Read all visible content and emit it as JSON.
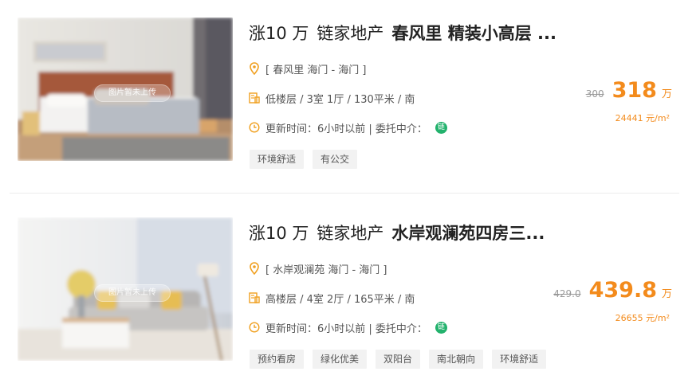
{
  "listings": [
    {
      "title_prefix": "涨10 万",
      "agency": "链家地产",
      "title_name": "春风里 精装小高层 ...",
      "address": "[ 春风里 海门 - 海门 ]",
      "specs": "低楼层 / 3室 1厅 / 130平米 / 南",
      "updated": "更新时间：6小时以前 | 委托中介：",
      "agent_badge": "链",
      "old_price": "300",
      "price": "318",
      "price_unit": "万",
      "unit_price": "24441 元/m²",
      "thumb_label": "图片暂未上传",
      "tags": [
        "环境舒适",
        "有公交"
      ]
    },
    {
      "title_prefix": "涨10 万",
      "agency": "链家地产",
      "title_name": "水岸观澜苑四房三...",
      "address": "[ 水岸观澜苑 海门 - 海门 ]",
      "specs": "高楼层 / 4室 2厅 / 165平米 / 南",
      "updated": "更新时间：6小时以前 | 委托中介：",
      "agent_badge": "链",
      "old_price": "429.0",
      "price": "439.8",
      "price_unit": "万",
      "unit_price": "26655 元/m²",
      "thumb_label": "图片暂未上传",
      "tags": [
        "预约看房",
        "绿化优美",
        "双阳台",
        "南北朝向",
        "环境舒适"
      ]
    }
  ],
  "icons": {
    "location": "location-pin-icon",
    "house": "house-document-icon",
    "clock": "clock-icon"
  },
  "colors": {
    "price": "#f38b1c",
    "icon": "#f0a020",
    "agent_badge": "#23b26d",
    "tag_bg": "#f2f2f2"
  }
}
